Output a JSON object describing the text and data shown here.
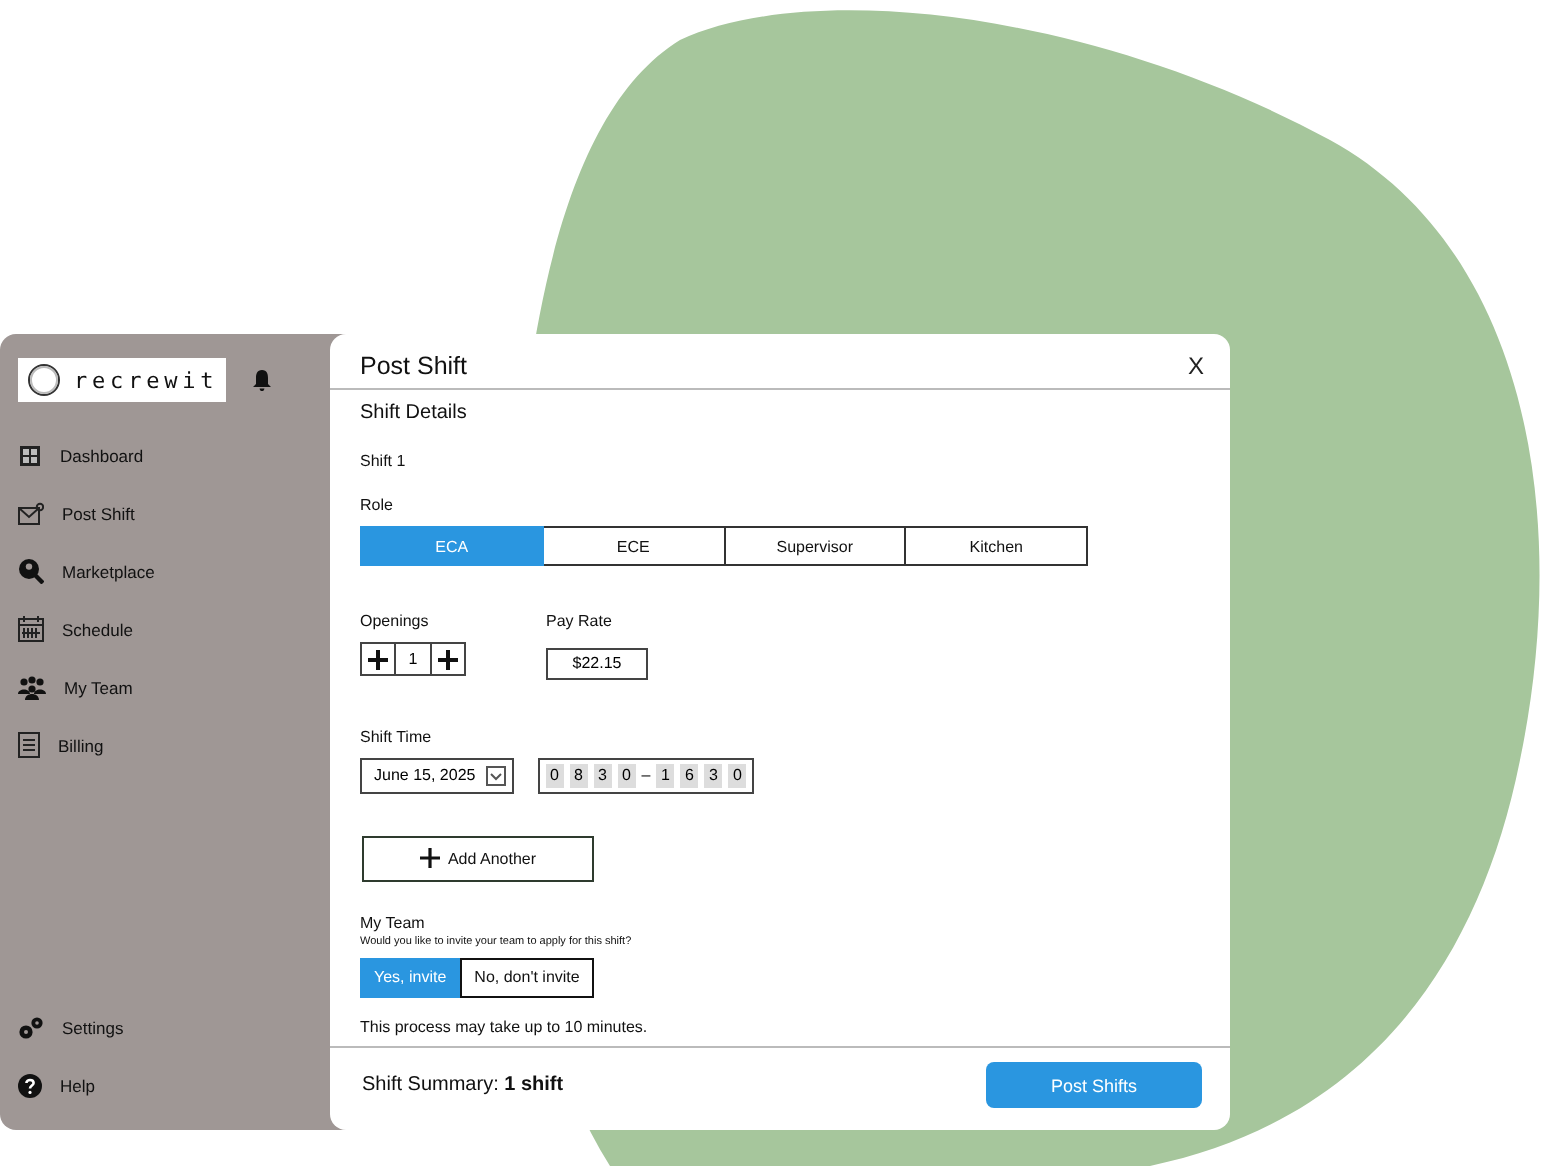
{
  "brand": {
    "name": "recrewit"
  },
  "sidebar": {
    "items": [
      {
        "label": "Dashboard",
        "kind": "grid"
      },
      {
        "label": "Post Shift",
        "kind": "mail"
      },
      {
        "label": "Marketplace",
        "kind": "search"
      },
      {
        "label": "Schedule",
        "kind": "calendar"
      },
      {
        "label": "My Team",
        "kind": "team"
      },
      {
        "label": "Billing",
        "kind": "bill"
      }
    ],
    "bottom_items": [
      {
        "label": "Settings",
        "kind": "gears"
      },
      {
        "label": "Help",
        "kind": "help"
      }
    ]
  },
  "modal": {
    "title": "Post Shift",
    "close": "X",
    "section": "Shift Details",
    "shift_label": "Shift 1",
    "role_label": "Role",
    "roles": [
      {
        "label": "ECA",
        "selected": true
      },
      {
        "label": "ECE",
        "selected": false
      },
      {
        "label": "Supervisor",
        "selected": false
      },
      {
        "label": "Kitchen",
        "selected": false
      }
    ],
    "openings_label": "Openings",
    "openings": "1",
    "pay_label": "Pay Rate",
    "pay": "$22.15",
    "time_label": "Shift Time",
    "date": "June 15, 2025",
    "start_digits": [
      "0",
      "8",
      "3",
      "0"
    ],
    "time_separator": "–",
    "end_digits": [
      "1",
      "6",
      "3",
      "0"
    ],
    "add_button": "Add Another",
    "team_label": "My Team",
    "team_question": "Would you like to invite your team to apply for this shift?",
    "invite_options": [
      {
        "label": "Yes, invite",
        "selected": true
      },
      {
        "label": "No, don't invite",
        "selected": false
      }
    ],
    "note": "This process may take up to 10 minutes.",
    "summary": "Shift Summary: **1 shift**",
    "submit": "Post Shifts"
  }
}
